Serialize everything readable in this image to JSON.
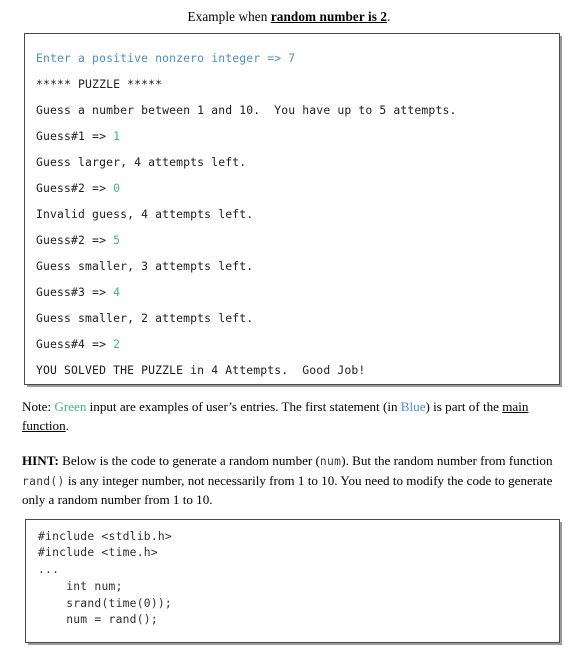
{
  "heading": {
    "prefix": "Example when ",
    "emphasis": "random number is 2",
    "suffix": "."
  },
  "console": {
    "lines": [
      {
        "text": "Enter a positive nonzero integer => ",
        "style": "blue",
        "value": "7",
        "value_style": "blue-bold"
      },
      {
        "text": "***** PUZZLE *****",
        "style": "plain",
        "value": "",
        "value_style": ""
      },
      {
        "text": "Guess a number between 1 and 10.  You have up to 5 attempts.",
        "style": "plain",
        "value": "",
        "value_style": ""
      },
      {
        "text": "Guess#1 => ",
        "style": "plain",
        "value": "1",
        "value_style": "green"
      },
      {
        "text": "Guess larger, 4 attempts left.",
        "style": "plain",
        "value": "",
        "value_style": ""
      },
      {
        "text": "Guess#2 => ",
        "style": "plain",
        "value": "0",
        "value_style": "green"
      },
      {
        "text": "Invalid guess, 4 attempts left.",
        "style": "plain",
        "value": "",
        "value_style": ""
      },
      {
        "text": "Guess#2 => ",
        "style": "plain",
        "value": "5",
        "value_style": "green"
      },
      {
        "text": "Guess smaller, 3 attempts left.",
        "style": "plain",
        "value": "",
        "value_style": ""
      },
      {
        "text": "Guess#3 => ",
        "style": "plain",
        "value": "4",
        "value_style": "green"
      },
      {
        "text": "Guess smaller, 2 attempts left.",
        "style": "plain",
        "value": "",
        "value_style": ""
      },
      {
        "text": "Guess#4 => ",
        "style": "plain",
        "value": "2",
        "value_style": "green"
      },
      {
        "text": "YOU SOLVED THE PUZZLE in 4 Attempts.  Good Job!",
        "style": "plain",
        "value": "",
        "value_style": ""
      }
    ]
  },
  "note": {
    "label": "Note: ",
    "green_word": "Green",
    "middle": " input are examples of user’s entries.  The first statement (in ",
    "blue_word": "Blue",
    "after_blue": ") is part of the ",
    "underlined": "main function",
    "end": "."
  },
  "hint": {
    "label": "HINT:",
    "part1": "  Below is the code to generate a random number (",
    "mono1": "num",
    "part2": "). But the random number from function ",
    "mono2": "rand()",
    "part3": " is any integer number, not necessarily from 1 to 10.  You need to modify the code to generate only a random number from 1 to 10."
  },
  "code": {
    "lines": [
      "#include <stdlib.h>",
      "#include <time.h>",
      "...",
      "    int num;",
      "    srand(time(0));",
      "    num = rand();"
    ]
  },
  "colors": {
    "green": "#3cb878",
    "blue": "#4a90c4",
    "text": "#000000",
    "box_border": "#4a4a4a",
    "box_shadow": "#9a9a9a"
  }
}
